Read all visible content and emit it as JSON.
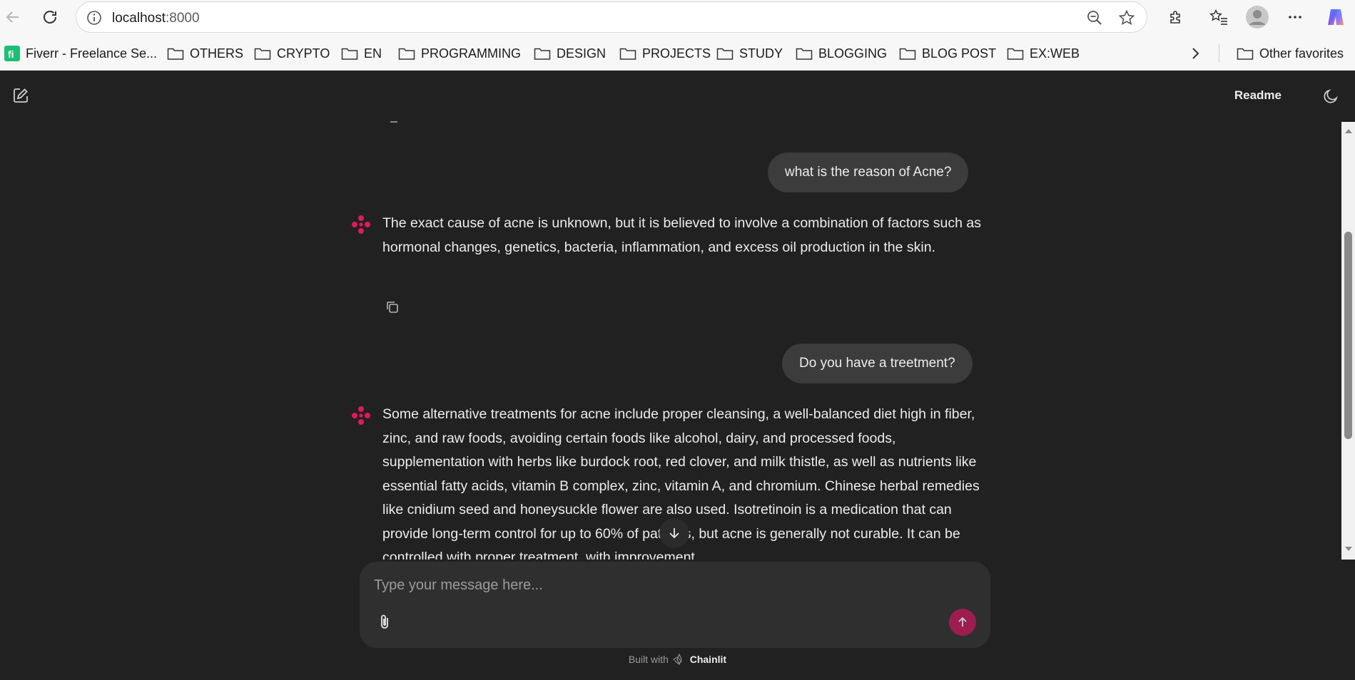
{
  "browser": {
    "url_host": "localhost",
    "url_port": ":8000"
  },
  "bookmarks": [
    {
      "label": "Fiverr - Freelance Se...",
      "icon": "fiverr-icon"
    },
    {
      "label": "OTHERS",
      "icon": "folder-icon"
    },
    {
      "label": "CRYPTO",
      "icon": "folder-icon"
    },
    {
      "label": "EN",
      "icon": "folder-icon"
    },
    {
      "label": "PROGRAMMING",
      "icon": "folder-icon"
    },
    {
      "label": "DESIGN",
      "icon": "folder-icon"
    },
    {
      "label": "PROJECTS",
      "icon": "folder-icon"
    },
    {
      "label": "STUDY",
      "icon": "folder-icon"
    },
    {
      "label": "BLOGGING",
      "icon": "folder-icon"
    },
    {
      "label": "BLOG POST",
      "icon": "folder-icon"
    },
    {
      "label": "EX:WEB",
      "icon": "folder-icon"
    }
  ],
  "other_favorites": "Other favorites",
  "app": {
    "readme": "Readme",
    "accent": "#c2185b"
  },
  "messages": [
    {
      "role": "user",
      "text": "what is the reason of Acne?"
    },
    {
      "role": "assistant",
      "text": "The exact cause of acne is unknown, but it is believed to involve a combination of factors such as hormonal changes, genetics, bacteria, inflammation, and excess oil production in the skin."
    },
    {
      "role": "user",
      "text": "Do you have a treetment?"
    },
    {
      "role": "assistant",
      "text": "Some alternative treatments for acne include proper cleansing, a well-balanced diet high in fiber, zinc, and raw foods, avoiding certain foods like alcohol, dairy, and processed foods, supplementation with herbs like burdock root, red clover, and milk thistle, as well as nutrients like essential fatty acids, vitamin B complex, zinc, vitamin A, and chromium. Chinese herbal remedies like cnidium seed and honeysuckle flower are also used. Isotretinoin is a medication that can provide long-term control for up to 60% of patients, but acne is generally not curable. It can be controlled with proper treatment, with improvement"
    }
  ],
  "composer": {
    "placeholder": "Type your message here..."
  },
  "footer": {
    "prefix": "Built with",
    "brand": "Chainlit"
  }
}
